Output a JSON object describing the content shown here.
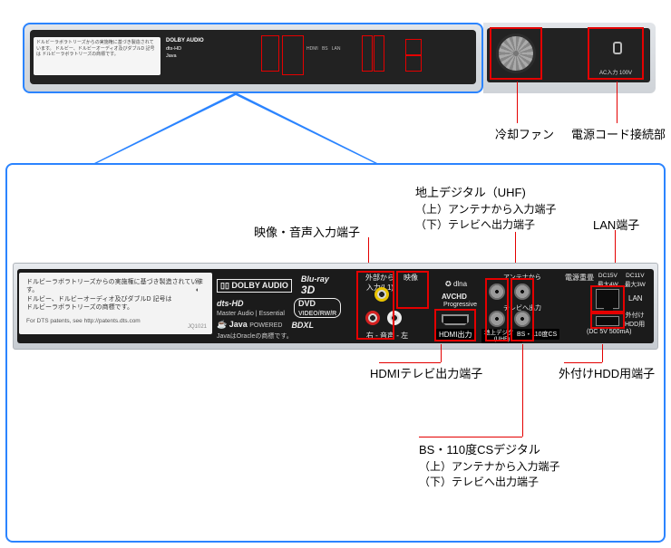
{
  "top_overview": {
    "disclaimer_jp": "ドルビーラボラトリーズからの実施権に基づき製造されています。\nドルビー、ドルビーオーディオ及びダブルD 記号は\nドルビーラボラトリーズの商標です。",
    "dts_link": "For DTS patents, see http://patents.dts.com"
  },
  "top_callout_fan": "冷却ファン",
  "top_callout_ac": "電源コード接続部",
  "ac_inlet_label": "AC入力 100V",
  "device_left": {
    "disclaimer_jp": "ドルビーラボラトリーズからの実施権に基づき製造されています。\nドルビー、ドルビーオーディオ及びダブルD 記号は\nドルビーラボラトリーズの商標です。",
    "dts_link": "For DTS patents, see http://patents.dts.com",
    "jq": "JQ1021"
  },
  "logos": {
    "dolby_audio": "DOLBY AUDIO",
    "bd3d": "Blu-ray\n3D",
    "dtshd": "dts-HD",
    "dtshd_sub": "Master Audio | Essential",
    "dvd": "DVD",
    "dvd_sub": "VIDEO/RW/R",
    "java": "Java",
    "java_sub": "POWERED",
    "java_note": "JavaはOracleの商標です。",
    "bdxl": "BDXL"
  },
  "port_labels": {
    "ext_in": "外部から\n入力(L1)",
    "video": "映像",
    "audio_rl": "右 - 音声 - 左",
    "dlna": "dlna",
    "avchd": "AVCHD",
    "avchd_sub": "Progressive",
    "hdmi_out": "HDMI出力",
    "ant_from": "アンテナから",
    "tv_to": "テレビへ出力",
    "terr": "地上デジタル\n(UHF)",
    "bs": "BS・110度CS",
    "psu": "電源重畳",
    "psu_a": "DC15V\n最大4W",
    "psu_b": "DC11V\n最大3W",
    "lan": "LAN",
    "ext_hdd": "外付け\nHDD用",
    "ext_hdd_spec": "(DC 5V 500mA)"
  },
  "callouts": {
    "av_in": "映像・音声入力端子",
    "terr_head": "地上デジタル（UHF)",
    "terr_l1": "（上）アンテナから入力端子",
    "terr_l2": "（下）テレビへ出力端子",
    "lan": "LAN端子",
    "hdmi": "HDMIテレビ出力端子",
    "exthdd": "外付けHDD用端子",
    "bs_head": "BS・110度CSデジタル",
    "bs_l1": "（上）アンテナから入力端子",
    "bs_l2": "（下）テレビへ出力端子"
  }
}
